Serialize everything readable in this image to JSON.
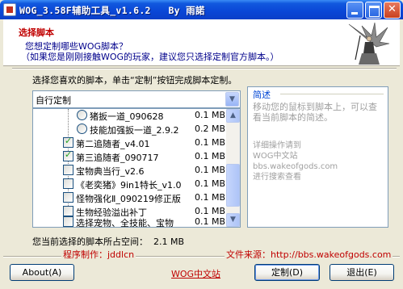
{
  "window": {
    "title": "WOG_3.58F辅助工具_v1.6.2   By 雨諾",
    "buttons": {
      "minimize": "minimize",
      "maximize": "maximize",
      "close": "✕"
    }
  },
  "header": {
    "title": "选择脚本",
    "line1": "您想定制哪些WOG脚本？",
    "line2": "（如果您是刚刚接触WOG的玩家，建议您只选择定制官方脚本。）"
  },
  "intro_text": "选择您喜欢的脚本，单击“定制”按钮完成脚本定制。",
  "preset": {
    "selected": "自行定制",
    "arrow": "▼"
  },
  "scripts": [
    {
      "type": "radio",
      "label": "猪扳一道_090628",
      "size": "0.1 MB",
      "checked": false
    },
    {
      "type": "radio",
      "label": "技能加强扳一道_2.9.2",
      "size": "0.2 MB",
      "checked": false
    },
    {
      "type": "check",
      "label": "第二追随者_v4.01",
      "size": "0.1 MB",
      "checked": true
    },
    {
      "type": "check",
      "label": "第三追随者_090717",
      "size": "0.1 MB",
      "checked": true
    },
    {
      "type": "check",
      "label": "宝物典当行_v2.6",
      "size": "0.1 MB",
      "checked": false
    },
    {
      "type": "check",
      "label": "《老奕猪》9in1特长_v1.0",
      "size": "0.1 MB",
      "checked": false
    },
    {
      "type": "check",
      "label": "怪物强化Ⅱ_090219修正版",
      "size": "0.1 MB",
      "checked": false
    },
    {
      "type": "check",
      "label": "生物经验溢出补丁",
      "size": "0.1 MB",
      "checked": false
    },
    {
      "type": "check",
      "label": "选择宠物、全技能、宝物",
      "size": "0.1 MB",
      "checked": false
    }
  ],
  "scrollbar": {
    "up": "▲",
    "down": "▼",
    "position": 0.62
  },
  "description": {
    "legend": "简述",
    "hint": "移动您的鼠标到脚本上，可以查看当前脚本的简述。",
    "help": "详细操作请到\nWOG中文站\nbbs.wakeofgods.com\n进行搜索查看"
  },
  "space_label": "您当前选择的脚本所占空间：  2.1 MB",
  "footer": {
    "author": "程序制作：jddlcn",
    "source": "文件来源：http://bbs.wakeofgods.com",
    "about_button": "About(A)",
    "site_link": "WOG中文站",
    "custom_button": "定制(D)",
    "exit_button": "退出(E)"
  },
  "colors": {
    "accent_red": "#c00000",
    "header_blue": "#00008b",
    "titlebar": "#0a46d6"
  }
}
